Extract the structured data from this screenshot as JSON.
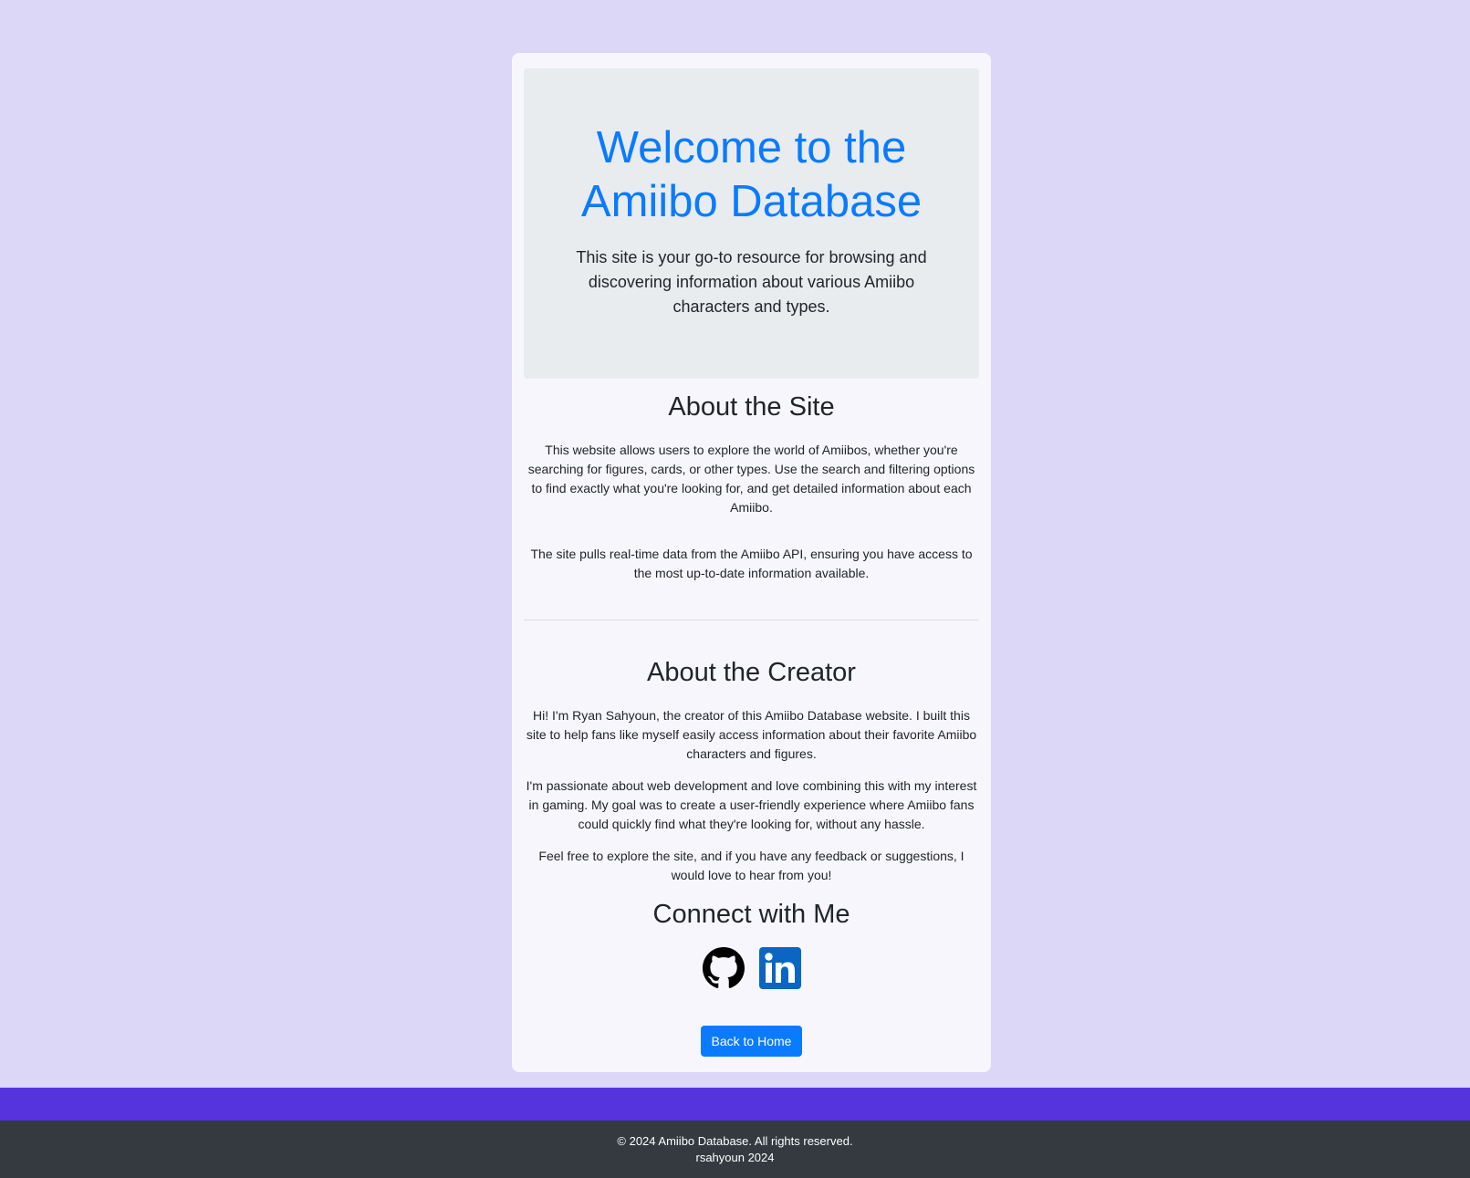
{
  "hero": {
    "title": "Welcome to the Amiibo Database",
    "lead": "This site is your go-to resource for browsing and discovering information about various Amiibo characters and types."
  },
  "about_site": {
    "heading": "About the Site",
    "paragraphs": [
      "This website allows users to explore the world of Amiibos, whether you're searching for figures, cards, or other types. Use the search and filtering options to find exactly what you're looking for, and get detailed information about each Amiibo.",
      "The site pulls real-time data from the Amiibo API, ensuring you have access to the most up-to-date information available."
    ]
  },
  "about_creator": {
    "heading": "About the Creator",
    "paragraphs": [
      "Hi! I'm Ryan Sahyoun, the creator of this Amiibo Database website. I built this site to help fans like myself easily access information about their favorite Amiibo characters and figures.",
      "I'm passionate about web development and love combining this with my interest in gaming. My goal was to create a user-friendly experience where Amiibo fans could quickly find what they're looking for, without any hassle.",
      "Feel free to explore the site, and if you have any feedback or suggestions, I would love to hear from you!"
    ]
  },
  "connect": {
    "heading": "Connect with Me",
    "links": [
      {
        "icon": "github-icon",
        "color": "#000000"
      },
      {
        "icon": "linkedin-icon",
        "color": "#0a66c2"
      }
    ]
  },
  "back_button": {
    "label": "Back to Home"
  },
  "footer": {
    "copyright": "© 2024 Amiibo Database. All rights reserved.",
    "credit": "rsahyoun 2024"
  },
  "colors": {
    "page_background": "#dcd6f7",
    "card_background": "#f7f6fd",
    "jumbotron_background": "#e9ecef",
    "title_blue": "#0a7bff",
    "button_blue": "#0a7bff",
    "accent_band": "#5533dd",
    "footer_background": "#343a40"
  }
}
